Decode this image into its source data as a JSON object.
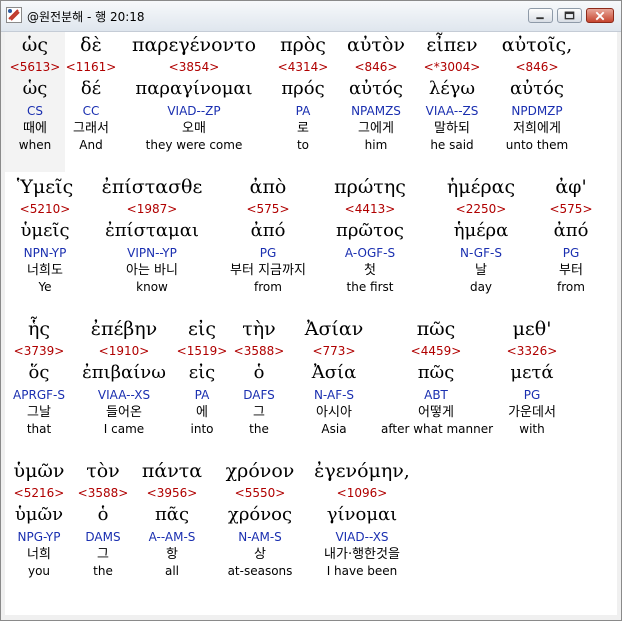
{
  "window": {
    "title": "@원전분해 - 행 20:18",
    "icon": "app-logo-icon",
    "controls": [
      "minimize-icon",
      "maximize-icon",
      "close-icon"
    ]
  },
  "rows": [
    [
      {
        "greek": "ὡς",
        "strong": "<5613>",
        "lemma": "ὡς",
        "parse": "CS",
        "korean": "때에",
        "english": "when"
      },
      {
        "greek": "δὲ",
        "strong": "<1161>",
        "lemma": "δέ",
        "parse": "CC",
        "korean": "그래서",
        "english": "And"
      },
      {
        "greek": "παρεγένοντο",
        "strong": "<3854>",
        "lemma": "παραγίνομαι",
        "parse": "VIAD--ZP",
        "korean": "오매",
        "english": "they were come"
      },
      {
        "greek": "πρὸς",
        "strong": "<4314>",
        "lemma": "πρός",
        "parse": "PA",
        "korean": "로",
        "english": "to"
      },
      {
        "greek": "αὐτὸν",
        "strong": "<846>",
        "lemma": "αὐτός",
        "parse": "NPAMZS",
        "korean": "그에게",
        "english": "him"
      },
      {
        "greek": "εἶπεν",
        "strong": "<*3004>",
        "lemma": "λέγω",
        "parse": "VIAA--ZS",
        "korean": "말하되",
        "english": "he said"
      },
      {
        "greek": "αὐτοῖς,",
        "strong": "<846>",
        "lemma": "αὐτός",
        "parse": "NPDMZP",
        "korean": "저희에게",
        "english": "unto them"
      }
    ],
    [
      {
        "greek": "Ὑμεῖς",
        "strong": "<5210>",
        "lemma": "ὑμεῖς",
        "parse": "NPN-YP",
        "korean": "너희도",
        "english": "Ye"
      },
      {
        "greek": "ἐπίστασθε",
        "strong": "<1987>",
        "lemma": "ἐπίσταμαι",
        "parse": "VIPN--YP",
        "korean": "아는 바니",
        "english": "know"
      },
      {
        "greek": "ἀπὸ",
        "strong": "<575>",
        "lemma": "ἀπό",
        "parse": "PG",
        "korean": "부터 지금까지",
        "english": "from"
      },
      {
        "greek": "πρώτης",
        "strong": "<4413>",
        "lemma": "πρῶτος",
        "parse": "A-OGF-S",
        "korean": "첫",
        "english": "the first"
      },
      {
        "greek": "ἡμέρας",
        "strong": "<2250>",
        "lemma": "ἡμέρα",
        "parse": "N-GF-S",
        "korean": "날",
        "english": "day"
      },
      {
        "greek": "ἀφ'",
        "strong": "<575>",
        "lemma": "ἀπό",
        "parse": "PG",
        "korean": "부터",
        "english": "from"
      }
    ],
    [
      {
        "greek": "ἧς",
        "strong": "<3739>",
        "lemma": "ὅς",
        "parse": "APRGF-S",
        "korean": "그날",
        "english": "that"
      },
      {
        "greek": "ἐπέβην",
        "strong": "<1910>",
        "lemma": "ἐπιβαίνω",
        "parse": "VIAA--XS",
        "korean": "들어온",
        "english": "I came"
      },
      {
        "greek": "εἰς",
        "strong": "<1519>",
        "lemma": "εἰς",
        "parse": "PA",
        "korean": "에",
        "english": "into"
      },
      {
        "greek": "τὴν",
        "strong": "<3588>",
        "lemma": "ὁ",
        "parse": "DAFS",
        "korean": "그",
        "english": "the"
      },
      {
        "greek": "Ἀσίαν",
        "strong": "<773>",
        "lemma": "Ἀσία",
        "parse": "N-AF-S",
        "korean": "아시아",
        "english": "Asia"
      },
      {
        "greek": "πῶς",
        "strong": "<4459>",
        "lemma": "πῶς",
        "parse": "ABT",
        "korean": "어떻게",
        "english": "after what manner"
      },
      {
        "greek": "μεθ'",
        "strong": "<3326>",
        "lemma": "μετά",
        "parse": "PG",
        "korean": "가운데서",
        "english": "with"
      }
    ],
    [
      {
        "greek": "ὑμῶν",
        "strong": "<5216>",
        "lemma": "ὑμῶν",
        "parse": "NPG-YP",
        "korean": "너희",
        "english": "you"
      },
      {
        "greek": "τὸν",
        "strong": "<3588>",
        "lemma": "ὁ",
        "parse": "DAMS",
        "korean": "그",
        "english": "the"
      },
      {
        "greek": "πάντα",
        "strong": "<3956>",
        "lemma": "πᾶς",
        "parse": "A--AM-S",
        "korean": "항",
        "english": "all"
      },
      {
        "greek": "χρόνον",
        "strong": "<5550>",
        "lemma": "χρόνος",
        "parse": "N-AM-S",
        "korean": "상",
        "english": "at-seasons"
      },
      {
        "greek": "ἐγενόμην,",
        "strong": "<1096>",
        "lemma": "γίνομαι",
        "parse": "VIAD--XS",
        "korean": "내가·행한것을",
        "english": "I have been"
      }
    ]
  ]
}
